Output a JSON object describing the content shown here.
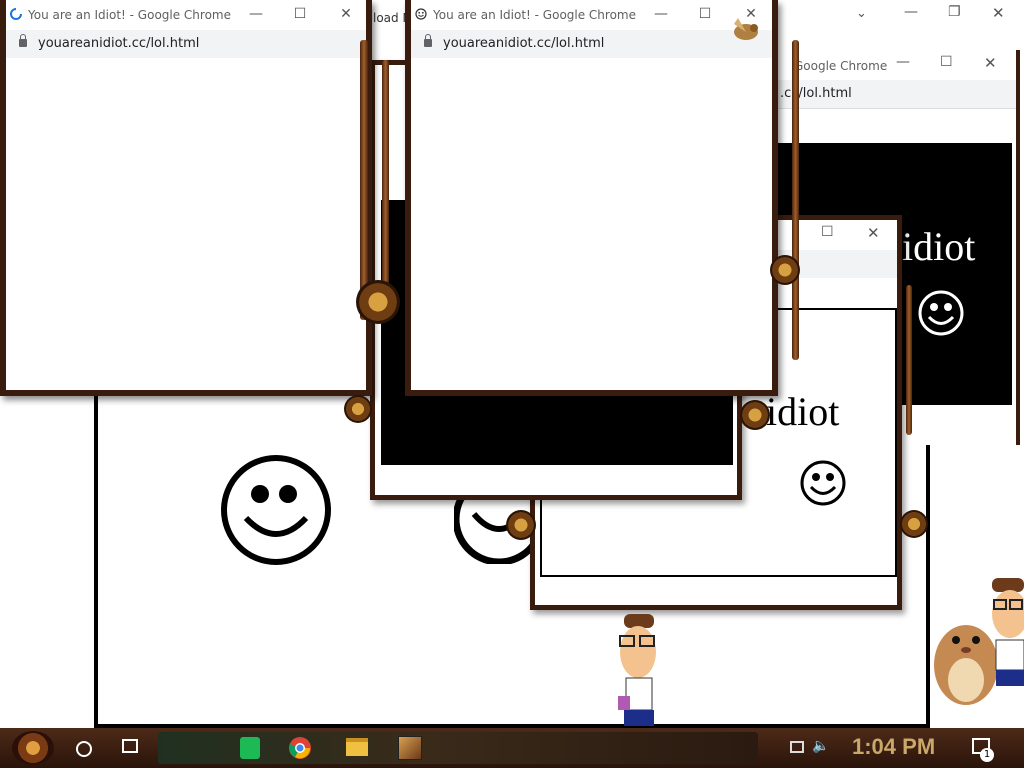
{
  "background_window": {
    "title": "Google Chrome",
    "url_fragment": ".cc/lol.html",
    "download_fragment": "load N",
    "idiot_text": "idiot"
  },
  "windows": [
    {
      "title": "You are an Idiot! - Google Chrome",
      "url": "youareanidiot.cc/lol.html",
      "loading": true
    },
    {
      "title": "You are an Idiot! - Google Chrome",
      "url": "youareanidiot.cc/lol.html",
      "loading": false
    }
  ],
  "mid_window": {
    "idiot_text": "idiot"
  },
  "taskbar": {
    "time": "1:04 PM",
    "notification_count": "1",
    "apps": [
      "start-orb",
      "cortana",
      "task-view",
      "spotify",
      "chrome",
      "file-explorer",
      "game-app"
    ]
  },
  "colors": {
    "frame": "#3a1c0e",
    "copper": "#a0602a",
    "time_text": "#c9a86a",
    "spotify": "#1db954"
  }
}
